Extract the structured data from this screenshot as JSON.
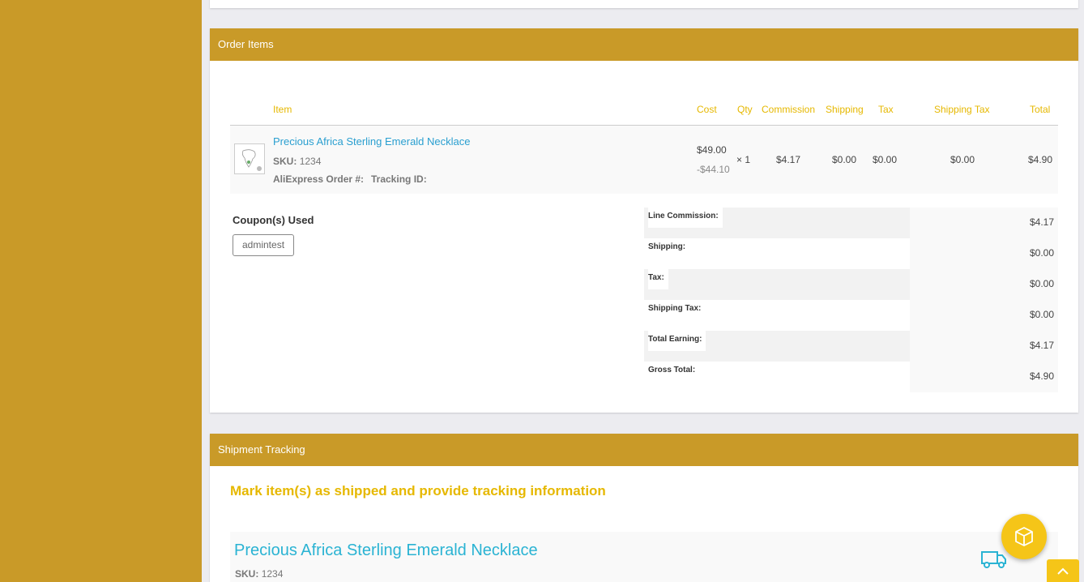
{
  "order_items": {
    "header": "Order Items",
    "columns": [
      "Item",
      "Cost",
      "Qty",
      "Commission",
      "Shipping",
      "Tax",
      "Shipping Tax",
      "Total"
    ],
    "item": {
      "name": "Precious Africa Sterling Emerald Necklace",
      "sku_label": "SKU:",
      "sku": "1234",
      "aliexpress_label": "AliExpress Order #:",
      "tracking_label": "Tracking ID:",
      "cost": "$49.00",
      "discount": "-$44.10",
      "qty": "× 1",
      "commission": "$4.17",
      "shipping": "$0.00",
      "tax": "$0.00",
      "shipping_tax": "$0.00",
      "total": "$4.90"
    },
    "coupons_title": "Coupon(s) Used",
    "coupon": "admintest",
    "summary": [
      {
        "label": "Line Commission:",
        "value": "$4.17"
      },
      {
        "label": "Shipping:",
        "value": "$0.00"
      },
      {
        "label": "Tax:",
        "value": "$0.00"
      },
      {
        "label": "Shipping Tax:",
        "value": "$0.00"
      },
      {
        "label": "Total Earning:",
        "value": "$4.17"
      },
      {
        "label": "Gross Total:",
        "value": "$4.90"
      }
    ]
  },
  "shipment": {
    "header": "Shipment Tracking",
    "title": "Mark item(s) as shipped and provide tracking information",
    "item_name": "Precious Africa Sterling Emerald Necklace",
    "sku_label": "SKU:",
    "sku": "1234"
  },
  "icons": {
    "truck": "truck-icon",
    "fab": "box-icon",
    "scroll": "chevron-up-icon"
  },
  "colors": {
    "accent": "#c99a28",
    "gold_text": "#e6b800",
    "link": "#2a9fd0",
    "fab": "#f5c518"
  }
}
